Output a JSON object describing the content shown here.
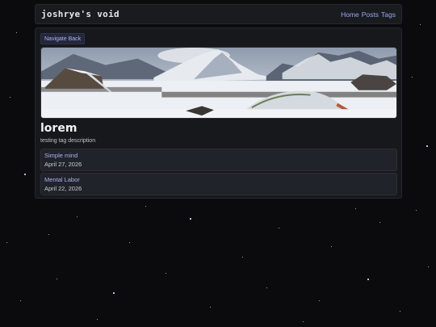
{
  "header": {
    "site_title": "joshrye's void",
    "nav": [
      {
        "label": "Home"
      },
      {
        "label": "Posts"
      },
      {
        "label": "Tags"
      }
    ]
  },
  "main": {
    "back_label": "Navigate Back",
    "tag_name": "lorem",
    "tag_description": "testing tag description",
    "posts": [
      {
        "title": "Simple mind",
        "date": "April 27, 2026"
      },
      {
        "title": "Mental Labor",
        "date": "April 22, 2026"
      }
    ]
  },
  "colors": {
    "background": "#0b0b0e",
    "panel": "#17181c",
    "card": "#21232a",
    "link": "#9aa8f0"
  }
}
